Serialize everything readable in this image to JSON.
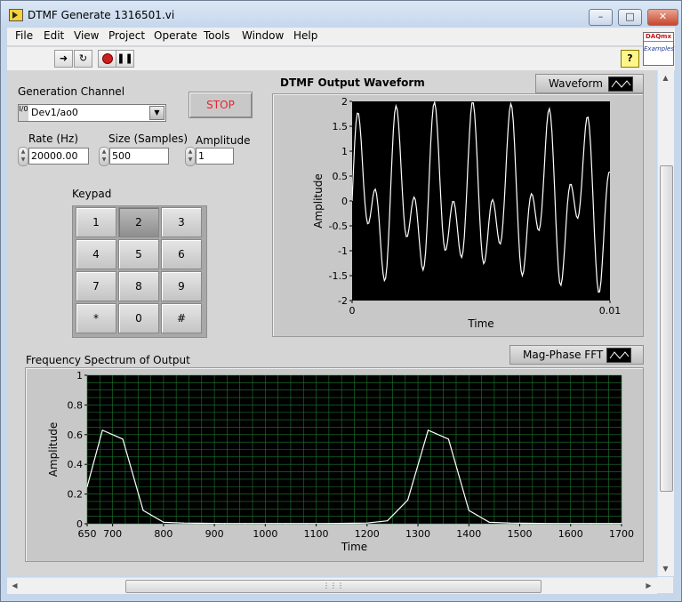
{
  "window": {
    "title": "DTMF Generate 1316501.vi",
    "minimize": "–",
    "maximize": "□",
    "close": "✕"
  },
  "menu": [
    "File",
    "Edit",
    "View",
    "Project",
    "Operate",
    "Tools",
    "Window",
    "Help"
  ],
  "toolbar": {
    "run_icon": "run-arrow-icon",
    "continuous_icon": "run-continuously-icon",
    "abort_icon": "abort-icon",
    "pause_icon": "pause-icon",
    "help_label": "?",
    "daqmx_line1": "DAQmx",
    "daqmx_line2": "Examples"
  },
  "controls": {
    "generation_channel_label": "Generation Channel",
    "generation_channel_value": "Dev1/ao0",
    "io_glyph": "I/0",
    "stop_label": "STOP",
    "rate_label": "Rate (Hz)",
    "rate_value": "20000.00",
    "size_label": "Size (Samples)",
    "size_value": "500",
    "amplitude_label": "Amplitude",
    "amplitude_value": "1",
    "keypad_label": "Keypad",
    "keys": [
      "1",
      "2",
      "3",
      "4",
      "5",
      "6",
      "7",
      "8",
      "9",
      "*",
      "0",
      "#"
    ],
    "active_key": "2"
  },
  "waveform_graph": {
    "title": "DTMF Output Waveform",
    "legend": "Waveform"
  },
  "fft_graph": {
    "title": "Frequency Spectrum of Output",
    "legend": "Mag-Phase FFT"
  },
  "colors": {
    "trace": "#ffffff",
    "plot_bg": "#000000",
    "fft_grid": "#1e7a2e",
    "stop_text": "#e8242c"
  },
  "chart_data": [
    {
      "type": "line",
      "title": "DTMF Output Waveform",
      "xlabel": "Time",
      "ylabel": "Amplitude",
      "xlim": [
        0,
        0.01
      ],
      "ylim": [
        -2,
        2
      ],
      "x_ticks": [
        "0",
        "0.01"
      ],
      "y_ticks": [
        "2",
        "1.5",
        "1",
        "0.5",
        "0",
        "-0.5",
        "-1",
        "-1.5",
        "-2"
      ],
      "grid": false,
      "series": [
        {
          "x_start": 0,
          "x_step": 5e-05,
          "count": 201,
          "frequencies_hz": [
            697,
            1336
          ],
          "amplitude_each": 1
        }
      ]
    },
    {
      "type": "line",
      "title": "Frequency Spectrum of Output",
      "xlabel": "Time",
      "ylabel": "Amplitude",
      "xlim": [
        650,
        1700
      ],
      "ylim": [
        0,
        1
      ],
      "x_ticks": [
        "650",
        "700",
        "800",
        "900",
        "1000",
        "1100",
        "1200",
        "1300",
        "1400",
        "1500",
        "1600",
        "1700"
      ],
      "y_ticks": [
        "1",
        "0.8",
        "0.6",
        "0.4",
        "0.2",
        "0"
      ],
      "grid": true,
      "series": [
        {
          "x": [
            650,
            680,
            720,
            760,
            800,
            840,
            880,
            920,
            960,
            1000,
            1040,
            1080,
            1120,
            1160,
            1200,
            1240,
            1280,
            1320,
            1360,
            1400,
            1440,
            1480,
            1520,
            1560,
            1600,
            1640,
            1680,
            1700
          ],
          "y": [
            0.25,
            0.63,
            0.57,
            0.09,
            0.01,
            0.005,
            0.003,
            0.002,
            0.002,
            0.002,
            0.002,
            0.002,
            0.002,
            0.003,
            0.005,
            0.02,
            0.16,
            0.63,
            0.57,
            0.09,
            0.01,
            0.005,
            0.003,
            0.002,
            0.002,
            0.002,
            0.002,
            0.002
          ]
        }
      ]
    }
  ]
}
